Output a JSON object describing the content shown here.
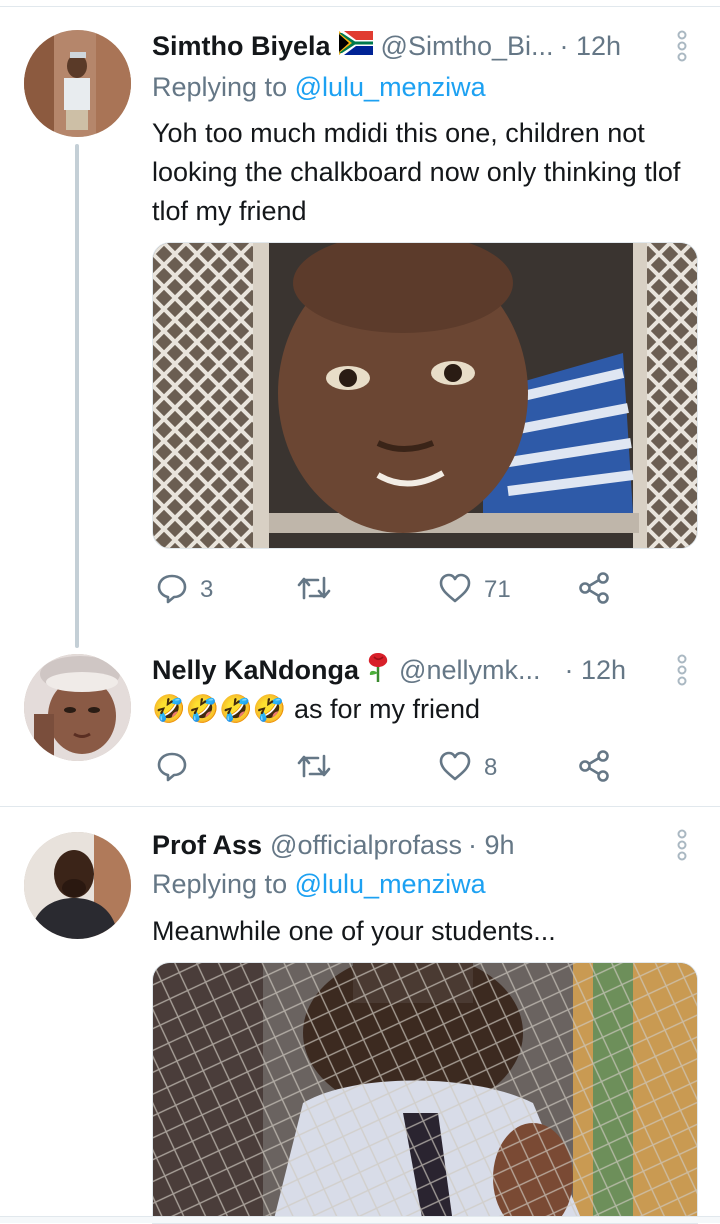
{
  "tweets": [
    {
      "name": "Simtho Biyela",
      "flag_icon": "south-africa-flag-icon",
      "handle": "@Simtho_Bi...",
      "time": "· 12h",
      "replying_prefix": "Replying to",
      "replying_to": "@lulu_menziwa",
      "text": "Yoh too much mdidi this one, children not looking the chalkboard now only thinking tlof tlof my friend",
      "replies": "3",
      "retweets": "",
      "likes": "71"
    },
    {
      "name": "Nelly KaNdonga",
      "emoji_icon": "rose-icon",
      "handle": "@nellymk...",
      "time": "· 12h",
      "text_emoji": "🤣🤣🤣🤣",
      "text": "as for my friend",
      "replies": "",
      "retweets": "",
      "likes": "8"
    },
    {
      "name": "Prof Ass",
      "handle": "@officialprofass",
      "time": "· 9h",
      "replying_prefix": "Replying to",
      "replying_to": "@lulu_menziwa",
      "text": "Meanwhile one of your students..."
    }
  ],
  "colors": {
    "text": "#14171a",
    "secondary": "#657786",
    "link": "#1da1f2",
    "divider": "#e1e8ed",
    "thread_line": "#c4cfd6"
  }
}
